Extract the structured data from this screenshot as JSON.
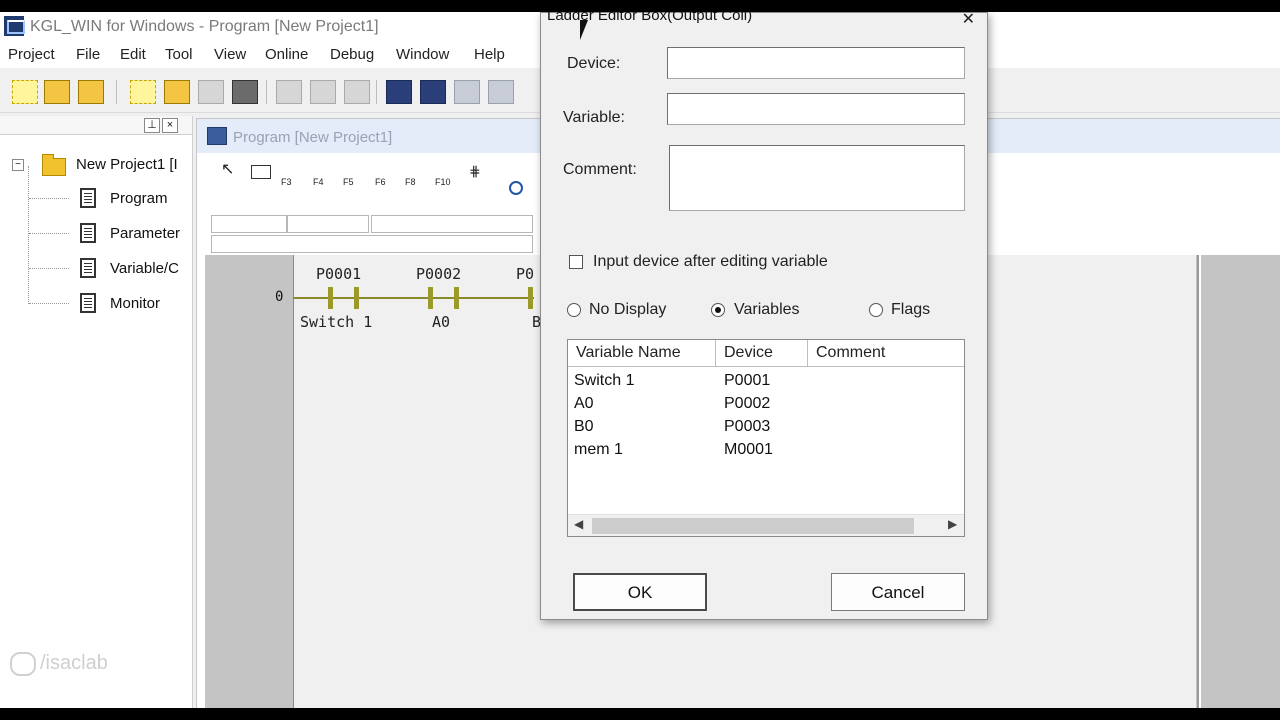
{
  "window": {
    "title": "KGL_WIN for Windows - Program [New Project1]"
  },
  "menu": [
    "Project",
    "File",
    "Edit",
    "Tool",
    "View",
    "Online",
    "Debug",
    "Window",
    "Help"
  ],
  "toolbar_icons": [
    "new-project-icon",
    "open-project-icon",
    "save-project-icon",
    "new-file-icon",
    "open-file-icon",
    "save-file-icon",
    "print-icon",
    "cut-icon",
    "copy-icon",
    "paste-icon",
    "ladder-icon",
    "ladder-insert-icon",
    "ladder-edit-icon",
    "ladder-delete-icon"
  ],
  "tree": {
    "root": "New Project1 [I",
    "items": [
      "Program",
      "Parameter",
      "Variable/C",
      "Monitor"
    ]
  },
  "program_window": {
    "title": "Program [New Project1]",
    "ladder_tools": [
      "F3",
      "F4",
      "F5",
      "F6",
      "F8",
      "F10"
    ],
    "rung_number": "0",
    "contacts": [
      {
        "device": "P0001",
        "variable": "Switch 1"
      },
      {
        "device": "P0002",
        "variable": "A0"
      },
      {
        "device": "P0",
        "variable": "B"
      }
    ]
  },
  "watermark": "/isaclab",
  "dialog": {
    "title": "Ladder Editor Box(Output Coil)",
    "close": "✕",
    "device_label": "Device:",
    "device_value": "",
    "variable_label": "Variable:",
    "variable_value": "",
    "comment_label": "Comment:",
    "comment_value": "",
    "checkbox_label": "Input device after editing variable",
    "checkbox_checked": false,
    "radios": [
      {
        "label": "No Display",
        "checked": false
      },
      {
        "label": "Variables",
        "checked": true
      },
      {
        "label": "Flags",
        "checked": false
      }
    ],
    "table": {
      "columns": [
        "Variable Name",
        "Device",
        "Comment"
      ],
      "rows": [
        {
          "name": "Switch 1",
          "device": "P0001",
          "comment": ""
        },
        {
          "name": "A0",
          "device": "P0002",
          "comment": ""
        },
        {
          "name": "B0",
          "device": "P0003",
          "comment": ""
        },
        {
          "name": "mem 1",
          "device": "M0001",
          "comment": ""
        }
      ]
    },
    "ok_label": "OK",
    "cancel_label": "Cancel"
  }
}
